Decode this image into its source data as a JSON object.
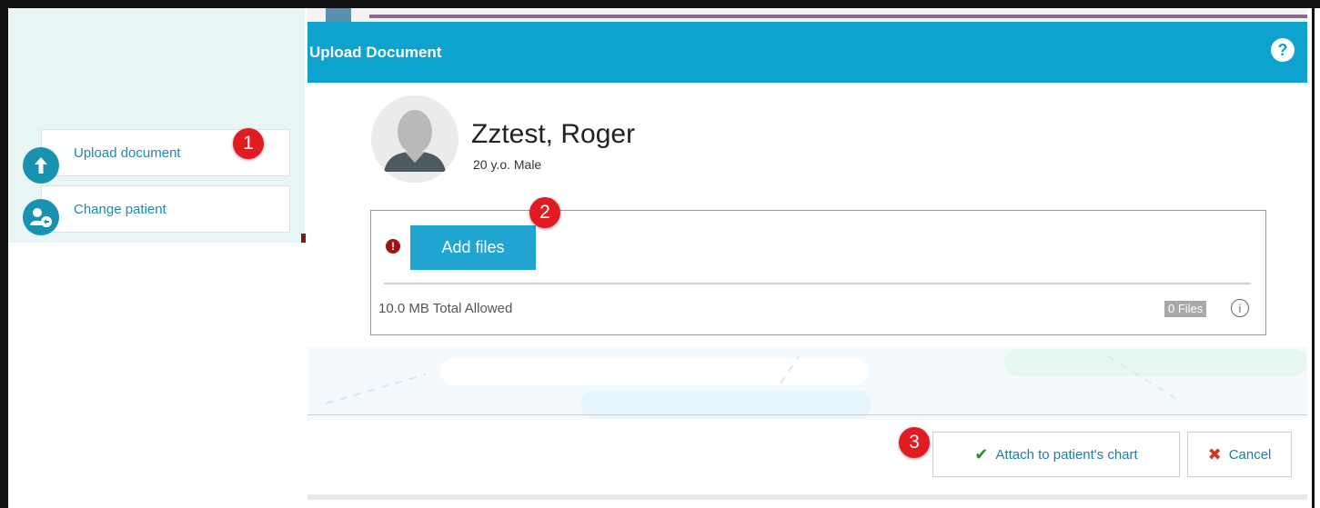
{
  "sidebar": {
    "upload_label": "Upload document",
    "change_label": "Change patient"
  },
  "badges": {
    "one": "1",
    "two": "2",
    "three": "3"
  },
  "dialog": {
    "title": "Upload Document",
    "help_glyph": "?",
    "patient": {
      "name": "Zztest, Roger",
      "meta": "20 y.o. Male"
    },
    "files": {
      "warn_glyph": "!",
      "add_files_label": "Add files",
      "total_allowed": "10.0 MB Total Allowed",
      "count_label": "0 Files",
      "info_glyph": "i"
    },
    "footer": {
      "check_glyph": "✔",
      "attach_label": "Attach to patient's chart",
      "x_glyph": "✖",
      "cancel_label": "Cancel"
    }
  },
  "colors": {
    "header_blue": "#0ea2cf",
    "button_blue": "#1fa5d0",
    "sidebar_bg": "#e8f6f5",
    "callout_red": "#e11b22",
    "warn_red": "#a31111",
    "check_green": "#2e8b3a",
    "cancel_red": "#cc3a2a"
  },
  "icons": {
    "upload": "arrow-up-circle-icon",
    "change_patient": "user-swap-icon",
    "help": "question-circle-icon",
    "warning": "exclamation-circle-icon",
    "info": "info-circle-icon",
    "check": "checkmark-icon",
    "cancel": "x-icon",
    "avatar": "user-silhouette-icon"
  }
}
